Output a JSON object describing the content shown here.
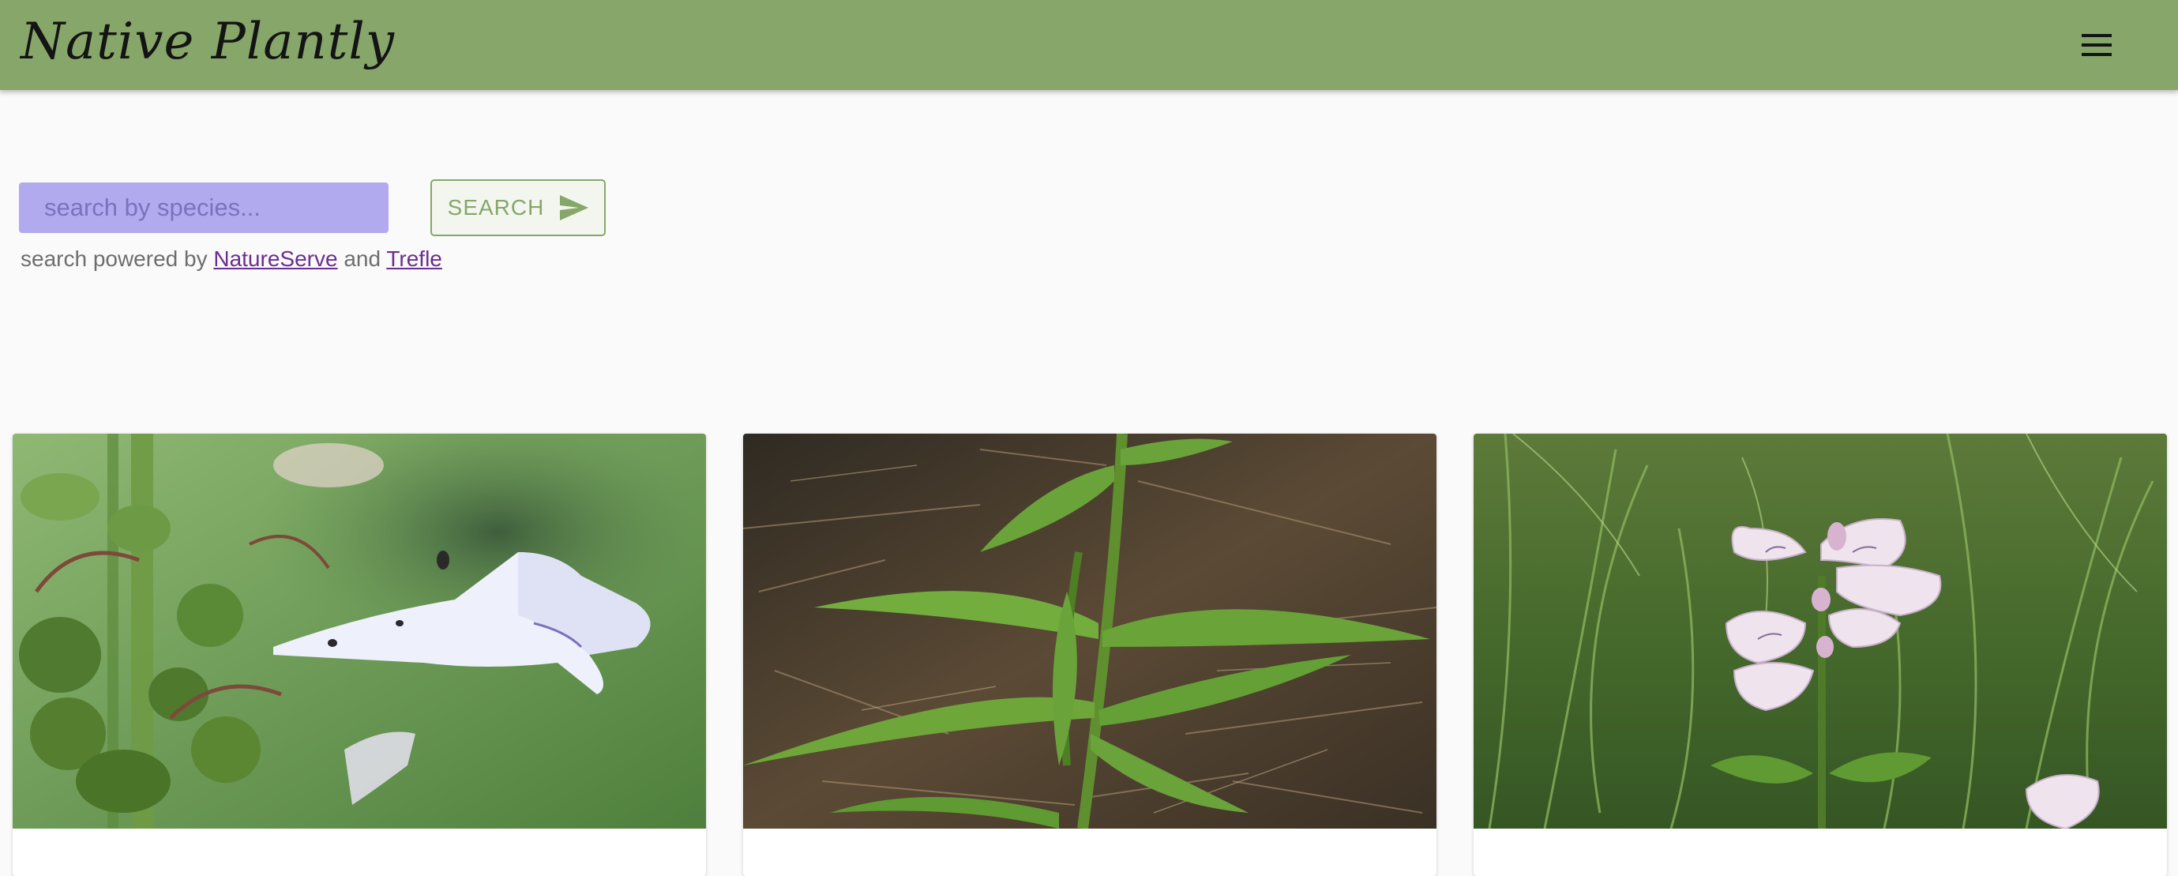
{
  "header": {
    "app_name": "Native Plantly",
    "menu_icon": "hamburger-menu-icon",
    "background_color": "#86a769"
  },
  "search": {
    "placeholder": "search by species...",
    "value": "",
    "button_label": "SEARCH",
    "button_icon": "send-icon",
    "input_color": "#b1aaef"
  },
  "attribution": {
    "prefix": "search powered by",
    "link1": "NatureServe",
    "connector": "and",
    "link2": "Trefle",
    "link_color": "#6b2f8f"
  },
  "cards": [
    {
      "image": "white-penstemon-flower-photo"
    },
    {
      "image": "green-leafy-stem-photo"
    },
    {
      "image": "pale-pink-beardtongue-photo"
    }
  ]
}
